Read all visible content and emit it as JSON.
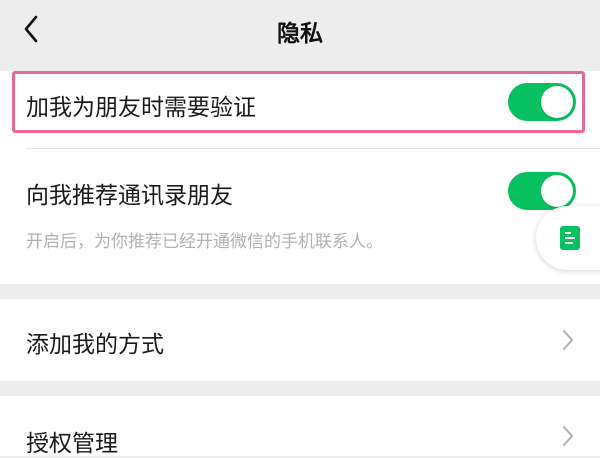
{
  "nav": {
    "title": "隐私",
    "back_icon": "chevron-left-icon"
  },
  "privacy": {
    "verify_friend": {
      "label": "加我为朋友时需要验证",
      "enabled": true
    },
    "recommend_contacts": {
      "label": "向我推荐通讯录朋友",
      "description": "开启后，为你推荐已经开通微信的手机联系人。",
      "enabled": true
    }
  },
  "menu": {
    "add_methods": {
      "label": "添加我的方式",
      "icon": "chevron-right-icon"
    },
    "authorization": {
      "label": "授权管理",
      "icon": "chevron-right-icon"
    }
  },
  "floating": {
    "icon": "note-icon"
  },
  "colors": {
    "accent": "#07c160",
    "highlight": "#e86a93",
    "background": "#ededed",
    "secondary_text": "#b2b2b2"
  }
}
